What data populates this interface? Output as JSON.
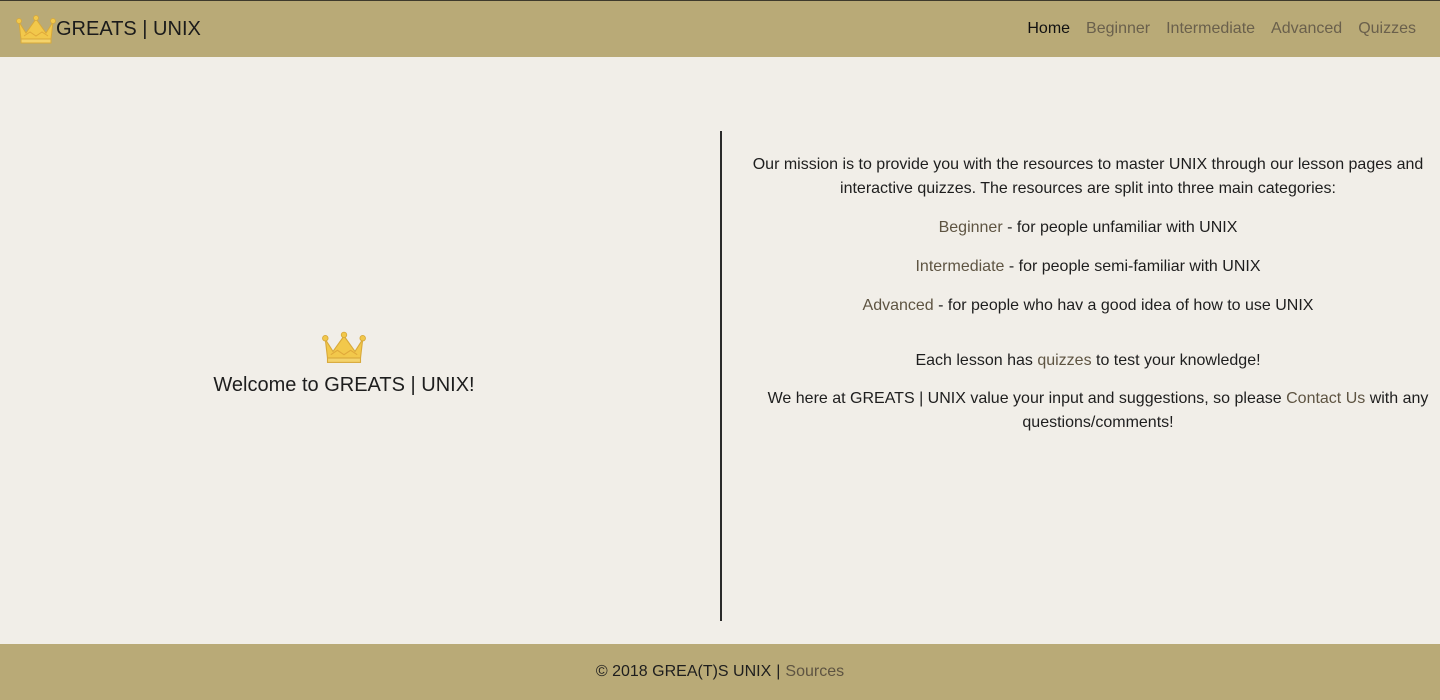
{
  "colors": {
    "navbar_bg": "#b9aa77",
    "page_bg": "#f1eee8",
    "link": "#5e5442",
    "crown_fill": "#f2c84b"
  },
  "navbar": {
    "brand_icon": "crown-icon",
    "brand_text": "GREATS | UNIX",
    "links": [
      {
        "label": "Home",
        "active": true
      },
      {
        "label": "Beginner"
      },
      {
        "label": "Intermediate"
      },
      {
        "label": "Advanced"
      },
      {
        "label": "Quizzes"
      }
    ]
  },
  "hero": {
    "icon": "crown-icon",
    "title": "Welcome to GREATS | UNIX!"
  },
  "mission": {
    "intro": "Our mission is to provide you with the resources to master UNIX through our lesson pages and interactive quizzes. The resources are split into three main categories:",
    "categories": [
      {
        "link": "Beginner",
        "desc": " - for people unfamiliar with UNIX"
      },
      {
        "link": "Intermediate",
        "desc": " - for people semi-familiar with UNIX"
      },
      {
        "link": "Advanced",
        "desc": " - for people who hav a good idea of how to use UNIX"
      }
    ],
    "lesson_prefix": "Each lesson has ",
    "lesson_link": "quizzes",
    "lesson_suffix": " to test your knowledge!",
    "input_prefix": "We here at GREATS | UNIX value your input and suggestions, so please ",
    "input_link": "Contact Us",
    "input_suffix": " with any questions/comments!"
  },
  "footer": {
    "copyright": "© 2018 GREA(T)S UNIX",
    "separator": "|",
    "sources_link": "Sources"
  }
}
